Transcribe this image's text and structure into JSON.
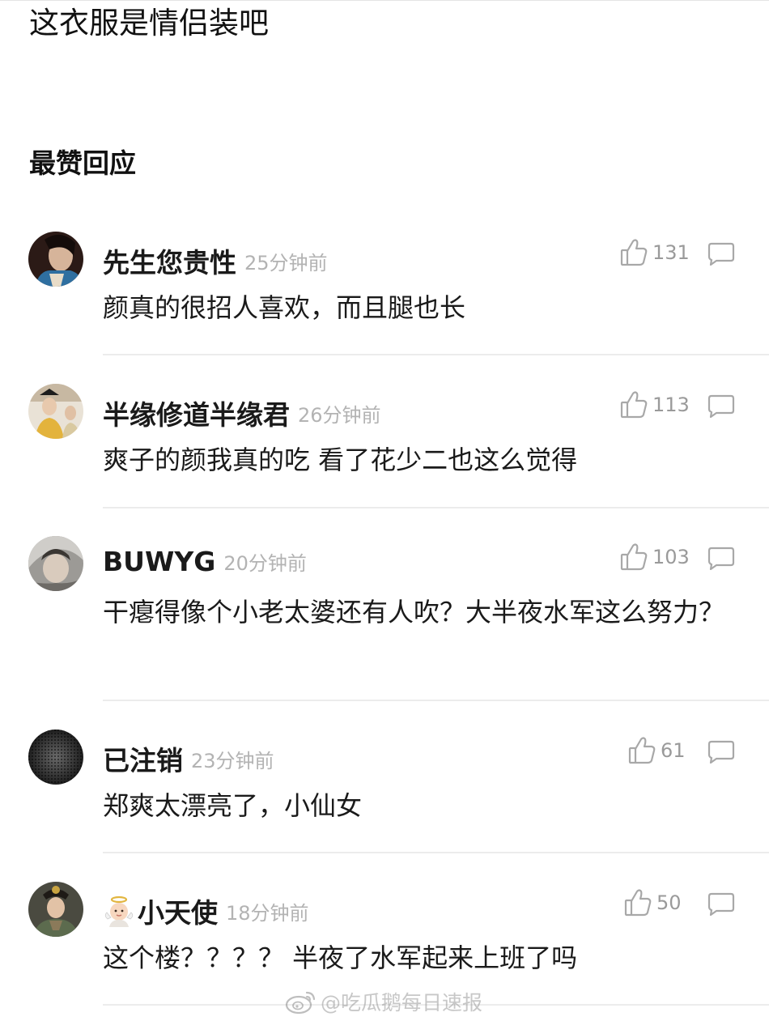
{
  "post": {
    "title": "这衣服是情侣装吧"
  },
  "section_heading": "最赞回应",
  "comments": [
    {
      "author": "先生您贵性",
      "time": "25分钟前",
      "likes": "131",
      "text": "颜真的很招人喜欢，而且腿也长",
      "avatar_icon": "avatar-photo"
    },
    {
      "author": "半缘修道半缘君",
      "time": "26分钟前",
      "likes": "113",
      "text": "爽子的颜我真的吃 看了花少二也这么觉得",
      "avatar_icon": "avatar-photo"
    },
    {
      "author": "BUWYG",
      "time": "20分钟前",
      "likes": "103",
      "text": "干瘪得像个小老太婆还有人吹？大半夜水军这么努力？",
      "avatar_icon": "avatar-photo"
    },
    {
      "author": "已注销",
      "time": "23分钟前",
      "likes": "61",
      "text": "郑爽太漂亮了，小仙女",
      "avatar_icon": "avatar-pattern"
    },
    {
      "author": "小天使",
      "time": "18分钟前",
      "likes": "50",
      "text": "这个楼？？？？ 半夜了水军起来上班了吗",
      "avatar_icon": "avatar-photo",
      "name_prefix_icon": "baby-angel-emoji"
    }
  ],
  "icons": {
    "like": "thumbs-up-icon",
    "reply": "speech-bubble-icon"
  },
  "watermark": {
    "text": "@吃瓜鹅每日速报",
    "icon": "weibo-logo"
  },
  "colors": {
    "text_primary": "#111111",
    "text_muted": "#b3b3b3",
    "icon_gray": "#a8a8a8",
    "divider": "#ececec"
  }
}
